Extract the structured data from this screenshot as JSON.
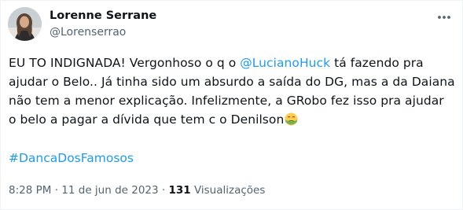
{
  "author": {
    "name": "Lorenne Serrane",
    "handle": "@Lorenserrao"
  },
  "tweet": {
    "text_part1": "EU TO INDIGNADA! Vergonhoso o q o ",
    "mention": "@LucianoHuck",
    "text_part2": " tá fazendo pra ajudar o Belo.. Já tinha sido um absurdo a saída do DG, mas a da Daiana não tem a menor explicação. Infelizmente, a GRobo fez isso pra ajudar o belo a pagar a dívida que tem c o Denilson",
    "emoji_icon": "nauseated-face-emoji",
    "hashtag": "#DancaDosFamosos"
  },
  "meta": {
    "time": "8:28 PM",
    "separator": " · ",
    "date": "11 de jun de 2023",
    "views_count": "131",
    "views_label": " Visualizações"
  },
  "colors": {
    "link": "#1d9bf0",
    "secondary_text": "#536471",
    "primary_text": "#0f1419"
  }
}
